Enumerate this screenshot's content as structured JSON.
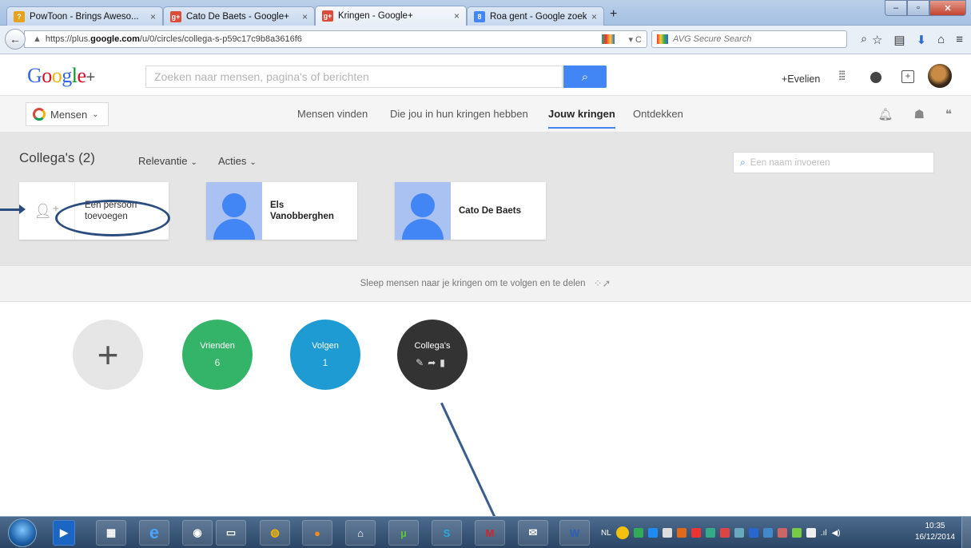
{
  "browser": {
    "tabs": [
      {
        "label": "PowToon - Brings Aweso...",
        "icon": "powtoon-favicon",
        "color": "#e8a21a",
        "active": false
      },
      {
        "label": "Cato De Baets - Google+",
        "icon": "google-plus-favicon",
        "color": "#dd4b39",
        "active": false
      },
      {
        "label": "Kringen - Google+",
        "icon": "google-plus-favicon",
        "color": "#dd4b39",
        "active": true
      },
      {
        "label": "Roa gent - Google zoeken",
        "icon": "google-search-favicon",
        "color": "#4285f4",
        "active": false
      }
    ],
    "url_prefix": "https://plus.",
    "url_domain": "google.com",
    "url_path": "/u/0/circles/collega-s-p59c17c9b8a3616f6",
    "search_placeholder": "AVG Secure Search"
  },
  "gplus": {
    "logo_letters": [
      "G",
      "o",
      "o",
      "g",
      "l",
      "e"
    ],
    "logo_plus": "+",
    "search_placeholder": "Zoeken naar mensen, pagina's of berichten",
    "user_name": "+Evelien",
    "section_dropdown": "Mensen",
    "tabs": [
      {
        "label": "Mensen vinden",
        "active": false
      },
      {
        "label": "Die jou in hun kringen hebben",
        "active": false
      },
      {
        "label": "Jouw kringen",
        "active": true
      },
      {
        "label": "Ontdekken",
        "active": false
      }
    ]
  },
  "circle": {
    "title": "Collega's (2)",
    "sort_label": "Relevantie",
    "actions_label": "Acties",
    "name_placeholder": "Een naam invoeren",
    "add_person": "Een persoon toevoegen",
    "members": [
      "Els Vanobberghen",
      "Cato De Baets"
    ]
  },
  "drag_hint": "Sleep mensen naar je kringen om te volgen en te delen",
  "circles": [
    {
      "name": "Vrienden",
      "count": "6",
      "color": "#34b468"
    },
    {
      "name": "Volgen",
      "count": "1",
      "color": "#1e9bd2"
    },
    {
      "name": "Collega's",
      "count": "",
      "color": "#333333"
    }
  ],
  "taskbar": {
    "apps": [
      "media-player",
      "file-explorer",
      "internet-explorer",
      "webcam",
      "scanner",
      "chrome",
      "firefox",
      "hp-photo",
      "utorrent",
      "skype",
      "mcafee",
      "mail",
      "word"
    ],
    "language": "NL",
    "time": "10:35",
    "date": "16/12/2014"
  }
}
